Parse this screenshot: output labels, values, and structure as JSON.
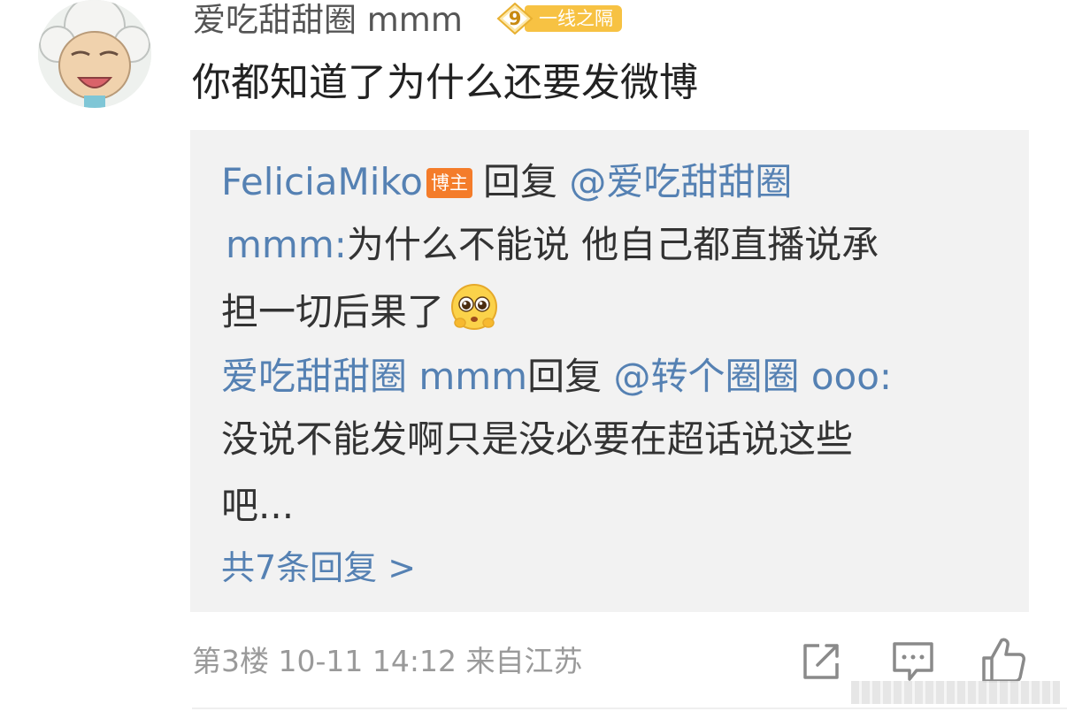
{
  "comment": {
    "username": "爱吃甜甜圈 mmm",
    "fan_badge": {
      "level": "9",
      "label": "一线之隔"
    },
    "text": "你都知道了为什么还要发微博",
    "floor": "第3楼",
    "datetime": "10-11 14:12",
    "location": "来自江苏"
  },
  "replies": [
    {
      "author": "FeliciaMiko",
      "author_badge": "博主",
      "reply_word": "回复",
      "mention": "@爱吃甜甜圈",
      "mention_cont": "mmm:",
      "text_1": "为什么不能说 他自己都直播说承",
      "text_2": "担一切后果了",
      "emoji": "pleading-face-icon"
    },
    {
      "author": "爱吃甜甜圈 mmm",
      "reply_word": "回复",
      "mention": "@转个圈圈 ooo:",
      "text_1": "没说不能发啊只是没必要在超话说这些",
      "text_2": "吧..."
    }
  ],
  "more_replies": "共7条回复 >",
  "actions": {
    "share": "share-icon",
    "comment": "comment-icon",
    "like": "thumbs-up-icon"
  },
  "colors": {
    "link_blue": "#5581b3",
    "op_badge": "#f47c2a",
    "fan_badge": "#f7c243",
    "meta_gray": "#9a9a9a",
    "reply_bg": "#f2f2f2"
  }
}
